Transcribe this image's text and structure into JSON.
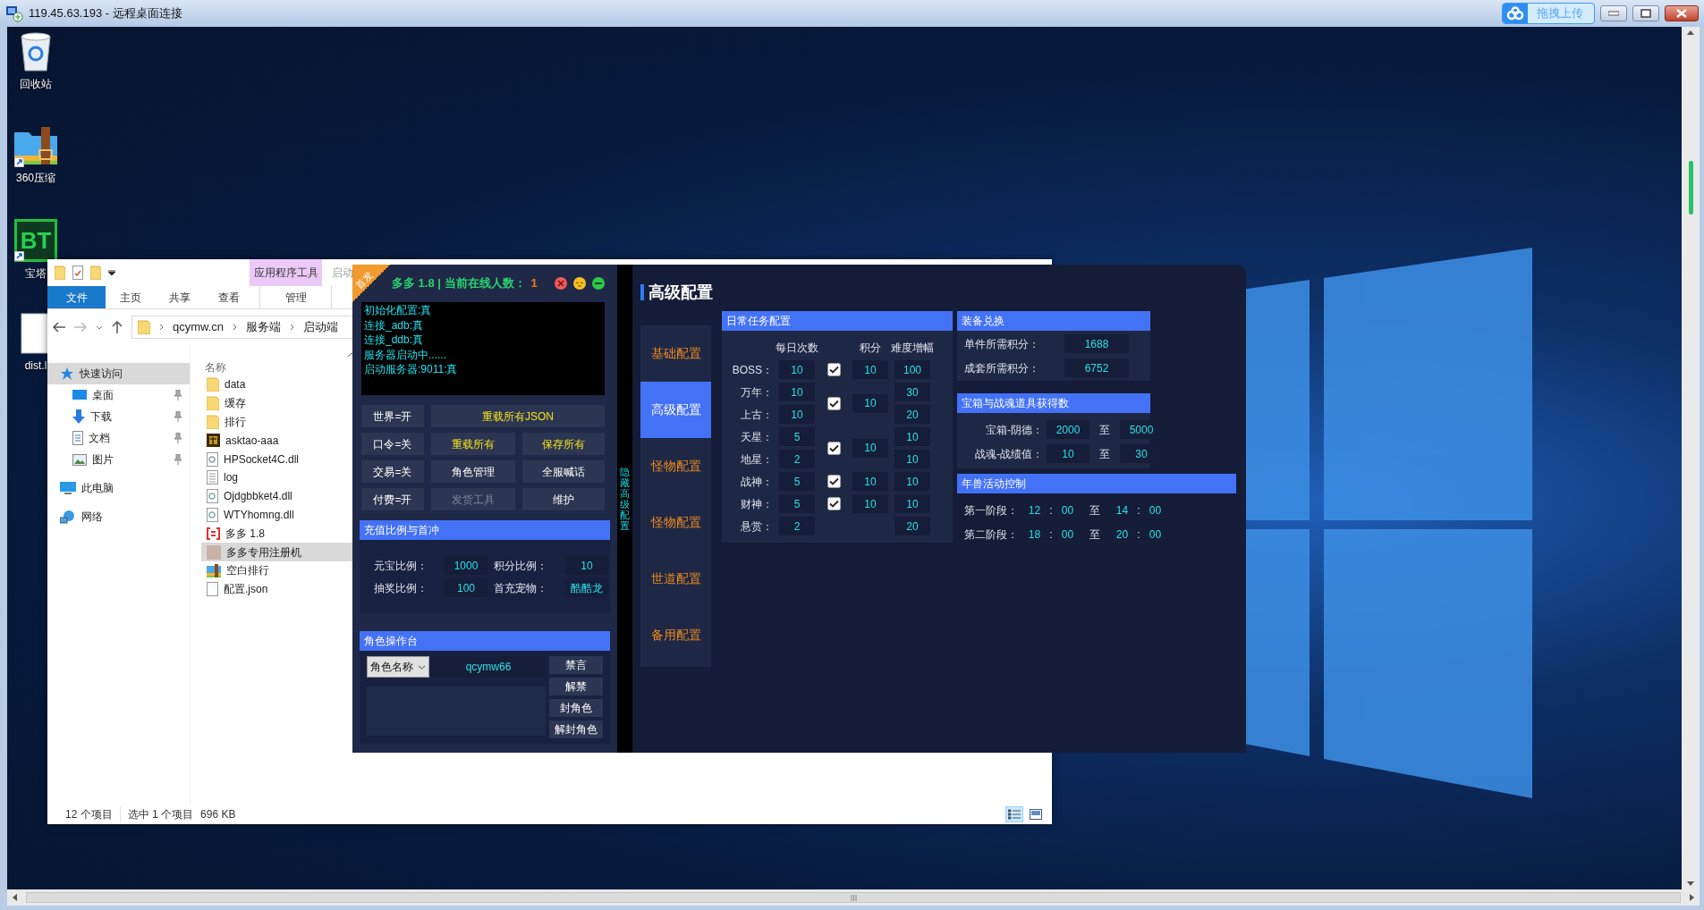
{
  "rdp": {
    "title": "119.45.63.193 - 远程桌面连接",
    "upload_label": "拖拽上传"
  },
  "desktop_icons": [
    {
      "kind": "recycle",
      "label": "回收站"
    },
    {
      "kind": "archive",
      "label": "360压缩"
    },
    {
      "kind": "bt",
      "label": "宝塔",
      "logo_text": "BT"
    },
    {
      "kind": "file",
      "label": "dist.l"
    }
  ],
  "explorer": {
    "context_tab": "应用程序工具",
    "title_partial": "启动",
    "tabs": [
      {
        "label": "文件",
        "selected": true
      },
      {
        "label": "主页",
        "selected": false
      },
      {
        "label": "共享",
        "selected": false
      },
      {
        "label": "查看",
        "selected": false
      },
      {
        "label": "管理",
        "selected": false
      }
    ],
    "breadcrumb": [
      "qcymw.cn",
      "服务端",
      "启动端"
    ],
    "nav": [
      {
        "kind": "star",
        "label": "快速访问",
        "selected": true,
        "pinned": false
      },
      {
        "kind": "desktop",
        "label": "桌面",
        "selected": false,
        "pinned": true
      },
      {
        "kind": "download",
        "label": "下载",
        "selected": false,
        "pinned": true
      },
      {
        "kind": "document",
        "label": "文档",
        "selected": false,
        "pinned": true
      },
      {
        "kind": "picture",
        "label": "图片",
        "selected": false,
        "pinned": true
      },
      {
        "kind": "pc",
        "label": "此电脑",
        "selected": false,
        "pinned": false
      },
      {
        "kind": "network",
        "label": "网络",
        "selected": false,
        "pinned": false
      }
    ],
    "column": "名称",
    "files": [
      {
        "kind": "folder",
        "name": "data",
        "selected": false
      },
      {
        "kind": "folder",
        "name": "缓存",
        "selected": false
      },
      {
        "kind": "folder",
        "name": "排行",
        "selected": false
      },
      {
        "kind": "game",
        "name": "asktao-aaa",
        "selected": false
      },
      {
        "kind": "dll",
        "name": "HPSocket4C.dll",
        "selected": false
      },
      {
        "kind": "text",
        "name": "log",
        "selected": false
      },
      {
        "kind": "dll",
        "name": "Ojdgbbket4.dll",
        "selected": false
      },
      {
        "kind": "dll",
        "name": "WTYhomng.dll",
        "selected": false
      },
      {
        "kind": "redapp",
        "name": "多多 1.8",
        "selected": false
      },
      {
        "kind": "photo",
        "name": "多多专用注册机",
        "selected": true
      },
      {
        "kind": "archive",
        "name": "空白排行",
        "selected": false
      },
      {
        "kind": "blank",
        "name": "配置.json",
        "selected": false
      }
    ],
    "status": {
      "count": "12 个项目",
      "selection": "选中 1 个项目",
      "size": "696 KB"
    },
    "views": [
      {
        "kind": "details",
        "selected": true
      },
      {
        "kind": "preview",
        "selected": false
      }
    ]
  },
  "app": {
    "badge": "首发",
    "title": "多多 1.8 | 当前在线人数：",
    "online": "1",
    "log": [
      "初始化配置:真",
      "连接_adb:真",
      "连接_ddb:真",
      "服务器启动中......",
      "启动服务器:9011:真"
    ],
    "buttons": [
      {
        "label": "世界=开",
        "highlighted": false,
        "wide": false,
        "disabled": false
      },
      {
        "label": "重载所有JSON",
        "highlighted": true,
        "wide": true,
        "disabled": false
      },
      {
        "label": "口令=关",
        "highlighted": false,
        "wide": false,
        "disabled": false
      },
      {
        "label": "重载所有",
        "highlighted": true,
        "wide": false,
        "disabled": false
      },
      {
        "label": "保存所有",
        "highlighted": true,
        "wide": false,
        "disabled": false
      },
      {
        "label": "交易=关",
        "highlighted": false,
        "wide": false,
        "disabled": false
      },
      {
        "label": "角色管理",
        "highlighted": false,
        "wide": false,
        "disabled": false
      },
      {
        "label": "全服喊话",
        "highlighted": false,
        "wide": false,
        "disabled": false
      },
      {
        "label": "付费=开",
        "highlighted": false,
        "wide": false,
        "disabled": false
      },
      {
        "label": "发货工具",
        "highlighted": false,
        "wide": false,
        "disabled": true
      },
      {
        "label": "维护",
        "highlighted": false,
        "wide": false,
        "disabled": false
      }
    ],
    "recharge": {
      "title": "充值比例与首冲",
      "fields": [
        {
          "label": "元宝比例：",
          "value": "1000"
        },
        {
          "label": "积分比例：",
          "value": "10"
        },
        {
          "label": "抽奖比例：",
          "value": "100"
        },
        {
          "label": "首充宠物：",
          "value": "酷酷龙"
        }
      ]
    },
    "role": {
      "title": "角色操作台",
      "select": "角色名称",
      "value": "qcymw66",
      "buttons": [
        "禁言",
        "解禁",
        "封角色",
        "解封角色"
      ]
    },
    "hide_toggle": "隐藏高级配置",
    "page_title": "高级配置",
    "sidebar": [
      {
        "label": "基础配置",
        "selected": false
      },
      {
        "label": "高级配置",
        "selected": true
      },
      {
        "label": "怪物配置",
        "selected": false
      },
      {
        "label": "怪物配置",
        "selected": false
      },
      {
        "label": "世道配置",
        "selected": false
      },
      {
        "label": "备用配置",
        "selected": false
      }
    ],
    "daily": {
      "title": "日常任务配置",
      "columns": [
        "每日次数",
        "积分",
        "难度增幅"
      ],
      "groups": [
        {
          "rows": [
            {
              "name": "BOSS：",
              "count": "10",
              "difficulty": "100"
            }
          ],
          "reward": {
            "checked": true,
            "points": "10"
          }
        },
        {
          "rows": [
            {
              "name": "万年：",
              "count": "10",
              "difficulty": "30"
            },
            {
              "name": "上古：",
              "count": "10",
              "difficulty": "20"
            }
          ],
          "reward": {
            "checked": true,
            "points": "10"
          }
        },
        {
          "rows": [
            {
              "name": "天星：",
              "count": "5",
              "difficulty": "10"
            },
            {
              "name": "地星：",
              "count": "2",
              "difficulty": "10"
            }
          ],
          "reward": {
            "checked": true,
            "points": "10"
          }
        },
        {
          "rows": [
            {
              "name": "战神：",
              "count": "5",
              "difficulty": "10"
            }
          ],
          "reward": {
            "checked": true,
            "points": "10"
          }
        },
        {
          "rows": [
            {
              "name": "财神：",
              "count": "5",
              "difficulty": "10"
            }
          ],
          "reward": {
            "checked": true,
            "points": "10"
          }
        },
        {
          "rows": [
            {
              "name": "悬赏：",
              "count": "2",
              "difficulty": "20"
            }
          ]
        }
      ]
    },
    "equip": {
      "title": "装备兑换",
      "fields": [
        {
          "label": "单件所需积分：",
          "value": "1688"
        },
        {
          "label": "成套所需积分：",
          "value": "6752"
        }
      ]
    },
    "treasure": {
      "title": "宝箱与战魂道具获得数",
      "ranges": [
        {
          "label": "宝箱-阴德：",
          "from": "2000",
          "sep": "至",
          "to": "5000"
        },
        {
          "label": "战魂-战绩值：",
          "from": "10",
          "sep": "至",
          "to": "30"
        }
      ]
    },
    "beast": {
      "title": "年兽活动控制",
      "stages": [
        {
          "label": "第一阶段：",
          "start": {
            "hour": "12",
            "colon": ":",
            "minute": "00"
          },
          "sep": "至",
          "end": {
            "hour": "14",
            "colon": ":",
            "minute": "00"
          }
        },
        {
          "label": "第二阶段：",
          "start": {
            "hour": "18",
            "colon": ":",
            "minute": "00"
          },
          "sep": "至",
          "end": {
            "hour": "20",
            "colon": ":",
            "minute": "00"
          }
        }
      ]
    }
  }
}
